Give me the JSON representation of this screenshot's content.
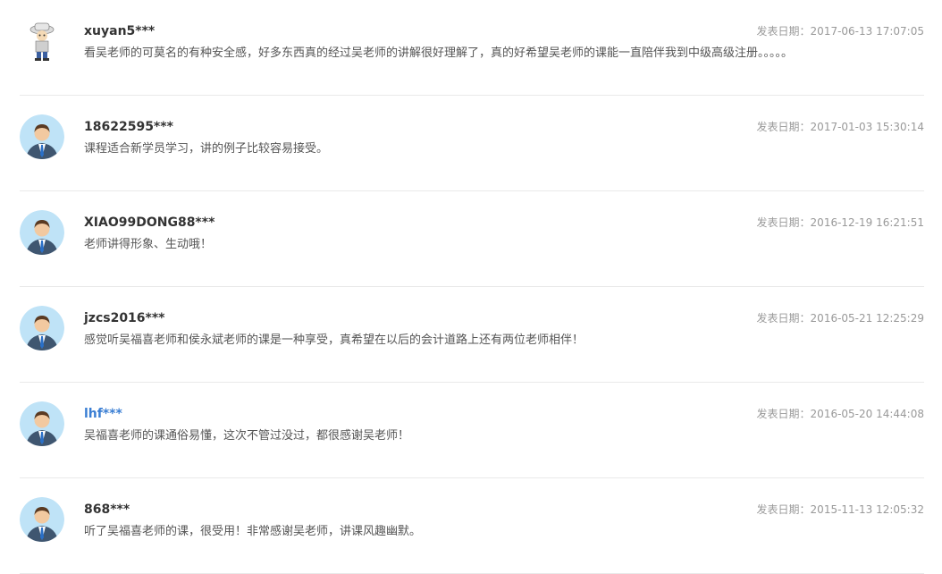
{
  "comments": [
    {
      "user": "xuyan5***",
      "date_label": "发表日期：",
      "date": "2017-06-13 17:07:05",
      "content": "看吴老师的可莫名的有种安全感，好多东西真的经过吴老师的讲解很好理解了，真的好希望吴老师的课能一直陪伴我到中级高级注册。。。。。",
      "avatar": "cartoon-avatar-icon",
      "highlight": false
    },
    {
      "user": "18622595***",
      "date_label": "发表日期：",
      "date": "2017-01-03 15:30:14",
      "content": "课程适合新学员学习，讲的例子比较容易接受。",
      "avatar": "default-user-avatar-icon",
      "highlight": false
    },
    {
      "user": "XIAO99DONG88***",
      "date_label": "发表日期：",
      "date": "2016-12-19 16:21:51",
      "content": "老师讲得形象、生动哦！",
      "avatar": "default-user-avatar-icon",
      "highlight": false
    },
    {
      "user": "jzcs2016***",
      "date_label": "发表日期：",
      "date": "2016-05-21 12:25:29",
      "content": "感觉听吴福喜老师和侯永斌老师的课是一种享受，真希望在以后的会计道路上还有两位老师相伴！",
      "avatar": "default-user-avatar-icon",
      "highlight": false
    },
    {
      "user": "lhf***",
      "date_label": "发表日期：",
      "date": "2016-05-20 14:44:08",
      "content": "吴福喜老师的课通俗易懂，这次不管过没过，都很感谢吴老师！",
      "avatar": "default-user-avatar-icon",
      "highlight": true
    },
    {
      "user": "868***",
      "date_label": "发表日期：",
      "date": "2015-11-13 12:05:32",
      "content": "听了吴福喜老师的课，很受用！非常感谢吴老师，讲课风趣幽默。",
      "avatar": "default-user-avatar-icon",
      "highlight": false
    }
  ],
  "colors": {
    "link_name": "#3a7ed3",
    "name": "#333333",
    "date": "#999999",
    "content": "#555555",
    "divider": "#e9e9e9"
  }
}
